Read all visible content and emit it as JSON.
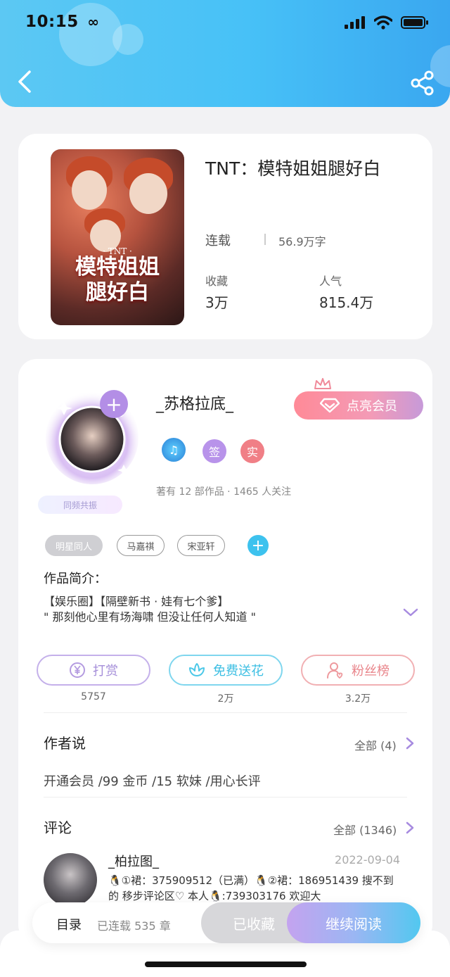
{
  "status_bar": {
    "time": "10:15"
  },
  "book": {
    "title": "TNT：模特姐姐腿好白",
    "cover_title_line1": "模特姐姐",
    "cover_title_line2": "腿好白",
    "cover_tnt": "· TNT ·",
    "status": "连载",
    "word_count": "56.9万字",
    "favorites_label": "收藏",
    "favorites_value": "3万",
    "popularity_label": "人气",
    "popularity_value": "815.4万"
  },
  "author": {
    "name": "_苏格拉底_",
    "vip_button": "点亮会员",
    "badge_sign": "签",
    "badge_real": "实",
    "works_info": "著有 12 部作品 · 1465 人关注",
    "resonance": "同频共振",
    "tags": [
      "明星同人",
      "马嘉祺",
      "宋亚轩"
    ],
    "intro_heading": "作品简介：",
    "intro_line1": "【娱乐圈】【隔壁新书 · 娃有七个爹】",
    "intro_line2": "\" 那刻他心里有场海啸 但没让任何人知道 \""
  },
  "actions": [
    {
      "label": "打赏",
      "count": "5757",
      "color": "#b49be0"
    },
    {
      "label": "免费送花",
      "count": "2万",
      "color": "#4cc8e8"
    },
    {
      "label": "粉丝榜",
      "count": "3.2万",
      "color": "#ee9a9e"
    }
  ],
  "author_said": {
    "heading": "作者说",
    "all": "全部 (4)",
    "text": "开通会员 /99 金币 /15 软妹 /用心长评"
  },
  "comments": {
    "heading": "评论",
    "all": "全部 (1346)",
    "first": {
      "user": "_柏拉图_",
      "date": "2022-09-04",
      "text": "🐧①裙：375909512（已满）🐧②裙：186951439 搜不到的 移步评论区♡ 本人🐧:739303176 欢迎大"
    }
  },
  "bottom_bar": {
    "toc": "目录",
    "chapters": "已连载 535 章",
    "collected": "已收藏",
    "continue": "继续阅读"
  }
}
